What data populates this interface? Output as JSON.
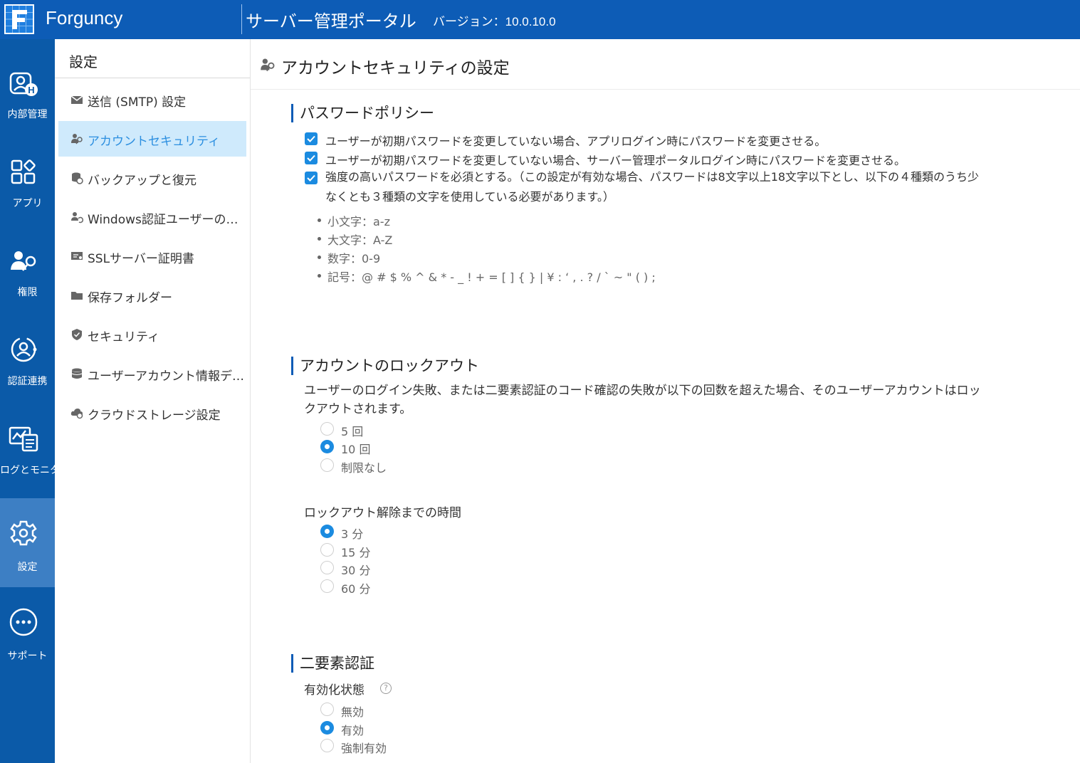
{
  "header": {
    "brand": "Forguncy",
    "portal_title": "サーバー管理ポータル",
    "version": "バージョン：10.0.10.0"
  },
  "rail": [
    {
      "label": "内部管理",
      "icon": "user-admin-icon"
    },
    {
      "label": "アプリ",
      "icon": "apps-icon"
    },
    {
      "label": "権限",
      "icon": "user-key-icon"
    },
    {
      "label": "認証連携",
      "icon": "auth-federation-icon"
    },
    {
      "label": "ログとモニター",
      "icon": "log-monitor-icon"
    },
    {
      "label": "設定",
      "icon": "gear-icon",
      "active": true
    },
    {
      "label": "サポート",
      "icon": "more-dots-icon"
    }
  ],
  "subnav": {
    "title": "設定",
    "items": [
      {
        "label": "送信 (SMTP) 設定",
        "icon": "mail-icon"
      },
      {
        "label": "アカウントセキュリティ",
        "icon": "user-key-icon",
        "active": true
      },
      {
        "label": "バックアップと復元",
        "icon": "backup-restore-icon"
      },
      {
        "label": "Windows認証ユーザーの同期",
        "icon": "user-sync-icon"
      },
      {
        "label": "SSLサーバー証明書",
        "icon": "certificate-icon"
      },
      {
        "label": "保存フォルダー",
        "icon": "folder-icon"
      },
      {
        "label": "セキュリティ",
        "icon": "shield-icon"
      },
      {
        "label": "ユーザーアカウント情報データベース",
        "icon": "database-icon"
      },
      {
        "label": "クラウドストレージ設定",
        "icon": "cloud-settings-icon"
      }
    ]
  },
  "page": {
    "title": "アカウントセキュリティの設定"
  },
  "password_policy": {
    "title": "パスワードポリシー",
    "options": [
      {
        "label": "ユーザーが初期パスワードを変更していない場合、アプリログイン時にパスワードを変更させる。",
        "checked": true
      },
      {
        "label": "ユーザーが初期パスワードを変更していない場合、サーバー管理ポータルログイン時にパスワードを変更させる。",
        "checked": true
      },
      {
        "label": "強度の高いパスワードを必須とする。（この設定が有効な場合、パスワードは8文字以上18文字以下とし、以下の４種類のうち少なくとも３種類の文字を使用している必要があります。）",
        "checked": true
      }
    ],
    "rules": [
      "小文字：a-z",
      "大文字：A-Z",
      "数字：0-9",
      "記号：@ # $ % ^ & * - _ ! + = [ ] { } | ¥ : ‘ , . ? / ` ~ \" ( ) ;"
    ]
  },
  "lockout": {
    "title": "アカウントのロックアウト",
    "description": "ユーザーのログイン失敗、または二要素認証のコード確認の失敗が以下の回数を超えた場合、そのユーザーアカウントはロックアウトされます。",
    "attempts": [
      {
        "label": "5 回",
        "selected": false
      },
      {
        "label": "10 回",
        "selected": true
      },
      {
        "label": "制限なし",
        "selected": false
      }
    ],
    "duration_label": "ロックアウト解除までの時間",
    "durations": [
      {
        "label": "3 分",
        "selected": true
      },
      {
        "label": "15 分",
        "selected": false
      },
      {
        "label": "30 分",
        "selected": false
      },
      {
        "label": "60 分",
        "selected": false
      }
    ]
  },
  "two_factor": {
    "title": "二要素認証",
    "status_label": "有効化状態",
    "help": "?",
    "options": [
      {
        "label": "無効",
        "selected": false
      },
      {
        "label": "有効",
        "selected": true
      },
      {
        "label": "強制有効",
        "selected": false
      }
    ]
  },
  "colors": {
    "header": "#0d5cb6",
    "rail": "#0b5aa8",
    "rail_active": "#3d7fc4",
    "accent": "#1b8be0",
    "nav_active_bg": "#cfeafc"
  }
}
